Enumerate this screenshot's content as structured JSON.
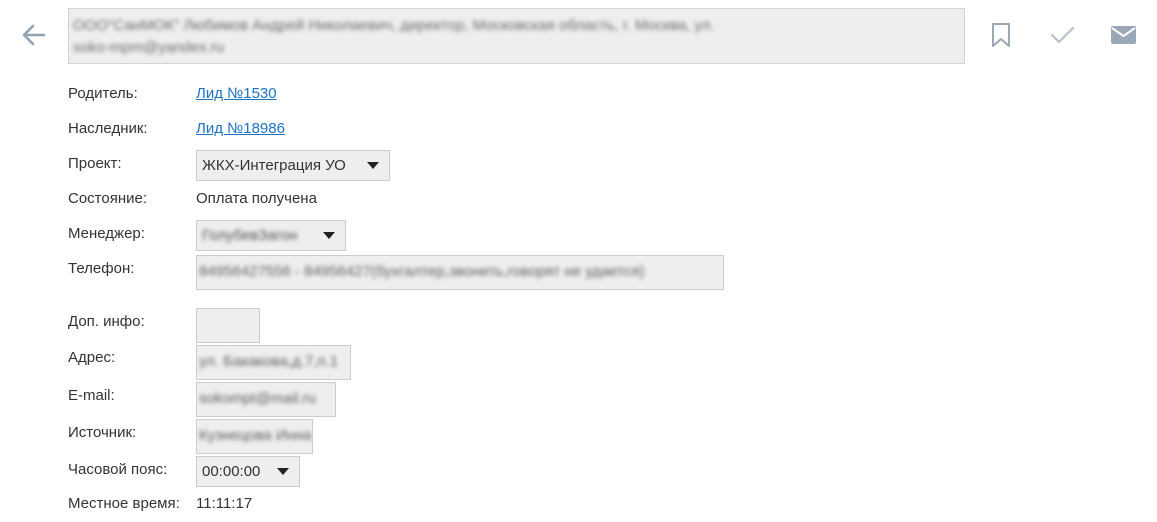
{
  "header": {
    "title_line1": "ООО\"СанМОК\" Любимов Андрей Николаевич, директор, Московская область, г. Москва, ул.",
    "title_line2": "soko-mpm@yandex.ru"
  },
  "icons": {
    "back": "arrow-left-icon",
    "bookmark": "bookmark-icon",
    "check": "check-icon",
    "mail": "mail-icon"
  },
  "fields": {
    "parent": {
      "label": "Родитель:",
      "value": "Лид №1530"
    },
    "successor": {
      "label": "Наследник:",
      "value": "Лид №18986"
    },
    "project": {
      "label": "Проект:",
      "value": "ЖКХ-Интеграция УО"
    },
    "status": {
      "label": "Состояние:",
      "value": "Оплата получена"
    },
    "manager": {
      "label": "Менеджер:",
      "value": "ГолубевЗагон"
    },
    "phone": {
      "label": "Телефон:",
      "value": "84956427556 - 84956427(бухгалтер,звонить,говорят не удается)"
    },
    "extra": {
      "label": "Доп. инфо:",
      "value": ""
    },
    "address": {
      "label": "Адрес:",
      "value": "ул. Бакакова,д.7,п.1"
    },
    "email": {
      "label": "E-mail:",
      "value": "sokompt@mail.ru"
    },
    "source": {
      "label": "Источник:",
      "value": "Кузнецова Инна"
    },
    "timezone": {
      "label": "Часовой пояс:",
      "value": "00:00:00"
    },
    "local_time": {
      "label": "Местное время:",
      "value": "11:11:17"
    }
  },
  "colors": {
    "link": "#1a73c6",
    "icon": "#9aa8b5",
    "field_bg": "#eeeeee"
  }
}
